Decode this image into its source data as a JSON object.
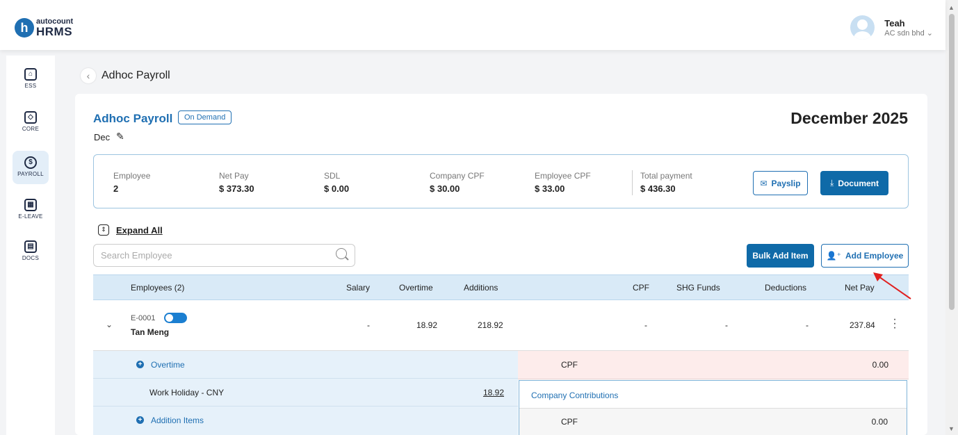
{
  "header": {
    "logo_letter": "h",
    "logo_top": "autocount",
    "logo_bottom": "HRMS",
    "user_name": "Teah",
    "user_company": "AC sdn bhd"
  },
  "sidebar": {
    "items": [
      {
        "label": "ESS",
        "icon": "ess-icon"
      },
      {
        "label": "CORE",
        "icon": "core-icon"
      },
      {
        "label": "PAYROLL",
        "icon": "payroll-icon",
        "active": true
      },
      {
        "label": "E-LEAVE",
        "icon": "calendar-icon"
      },
      {
        "label": "DOCS",
        "icon": "docs-icon"
      }
    ]
  },
  "breadcrumb": {
    "title": "Adhoc Payroll"
  },
  "payroll": {
    "title": "Adhoc Payroll",
    "badge": "On Demand",
    "subtitle": "Dec",
    "period": "December 2025"
  },
  "summary": {
    "items": [
      {
        "label": "Employee",
        "value": "2"
      },
      {
        "label": "Net Pay",
        "value": "$ 373.30"
      },
      {
        "label": "SDL",
        "value": "$ 0.00"
      },
      {
        "label": "Company CPF",
        "value": "$ 30.00"
      },
      {
        "label": "Employee CPF",
        "value": "$ 33.00"
      },
      {
        "label": "Total payment",
        "value": "$ 436.30"
      }
    ],
    "payslip_label": "Payslip",
    "document_label": "Document"
  },
  "toolbar": {
    "expand_all": "Expand All",
    "search_placeholder": "Search Employee",
    "bulk_add_label": "Bulk Add Item",
    "add_employee_label": "Add Employee"
  },
  "table": {
    "columns": [
      "Employees (2)",
      "Salary",
      "Overtime",
      "Additions",
      "CPF",
      "SHG Funds",
      "Deductions",
      "Net Pay"
    ],
    "rows": [
      {
        "code": "E-0001",
        "name": "Tan Meng",
        "salary": "-",
        "overtime": "18.92",
        "additions": "218.92",
        "cpf": "-",
        "shg": "-",
        "deductions": "-",
        "net_pay": "237.84"
      }
    ]
  },
  "detail": {
    "overtime_label": "Overtime",
    "overtime_item": "Work Holiday - CNY",
    "overtime_value": "18.92",
    "addition_label": "Addition Items",
    "cpf_label": "CPF",
    "cpf_value": "0.00",
    "company_contrib_label": "Company Contributions",
    "company_cpf_label": "CPF",
    "company_cpf_value": "0.00"
  },
  "colors": {
    "accent": "#1f6fb2",
    "header_bg": "#d9eaf7",
    "detail_bg": "#e6f1fa",
    "cpf_bg": "#fdeceb",
    "arrow": "#e02020"
  }
}
